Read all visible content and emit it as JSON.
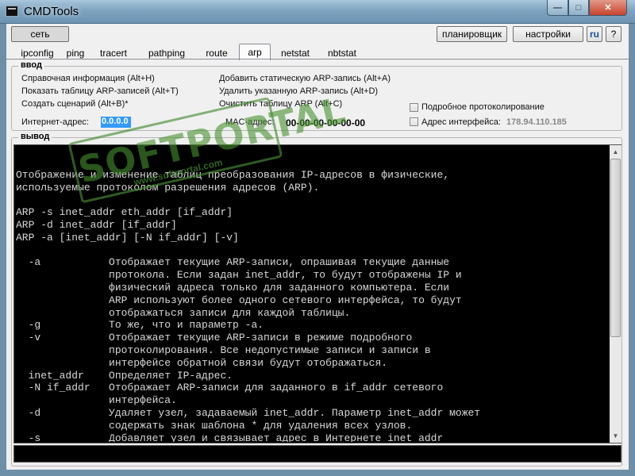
{
  "window": {
    "title": "CMDTools",
    "minimize_glyph": "—",
    "maximize_glyph": "□",
    "close_glyph": "✕"
  },
  "toolbar": {
    "network_label": "сеть",
    "scheduler_label": "планировщик",
    "settings_label": "настройки",
    "lang_label": "ru",
    "help_label": "?"
  },
  "tabs": [
    {
      "label": "ipconfig",
      "active": false
    },
    {
      "label": "ping",
      "active": false
    },
    {
      "label": "tracert",
      "active": false
    },
    {
      "label": "pathping",
      "active": false
    },
    {
      "label": "route",
      "active": false
    },
    {
      "label": "arp",
      "active": true
    },
    {
      "label": "netstat",
      "active": false
    },
    {
      "label": "nbtstat",
      "active": false
    }
  ],
  "input_group": {
    "legend": "ввод",
    "actions_left": [
      "Справочная информация (Alt+H)",
      "Показать таблицу ARP-записей (Alt+T)",
      "Создать сценарий (Alt+B)*"
    ],
    "actions_right": [
      "Добавить статическую ARP-запись (Alt+A)",
      "Удалить указанную ARP-запись (Alt+D)",
      "Очистить таблицу ARP (Alt+C)"
    ],
    "internet_address_label": "Интернет-адрес:",
    "internet_address_value": "0.0.0.0",
    "mac_address_label": "MAC-адрес:",
    "mac_address_value": "00-00-00-00-00-00",
    "verbose_log_label": "Подробное протоколирование",
    "verbose_log_checked": false,
    "interface_address_label": "Адрес интерфейса:",
    "interface_address_checked": false,
    "interface_address_value": "178.94.110.185"
  },
  "output_group": {
    "legend": "вывод",
    "console_lines": [
      "",
      "Отображение и изменение таблиц преобразования IP-адресов в физические,",
      "используемые протоколом разрешения адресов (ARP).",
      "",
      "ARP -s inet_addr eth_addr [if_addr]",
      "ARP -d inet_addr [if_addr]",
      "ARP -a [inet_addr] [-N if_addr] [-v]",
      "",
      "  -a           Отображает текущие ARP-записи, опрашивая текущие данные",
      "               протокола. Если задан inet_addr, то будут отображены IP и",
      "               физический адреса только для заданного компьютера. Если",
      "               ARP используют более одного сетевого интерфейса, то будут",
      "               отображаться записи для каждой таблицы.",
      "  -g           То же, что и параметр -a.",
      "  -v           Отображает текущие ARP-записи в режиме подробного",
      "               протоколирования. Все недопустимые записи и записи в",
      "               интерфейсе обратной связи будут отображаться.",
      "  inet_addr    Определяет IP-адрес.",
      "  -N if_addr   Отображает ARP-записи для заданного в if_addr сетевого",
      "               интерфейса.",
      "  -d           Удаляет узел, задаваемый inet_addr. Параметр inet_addr может",
      "               содержать знак шаблона * для удаления всех узлов.",
      "  -s           Добавляет узел и связывает адрес в Интернете inet_addr"
    ],
    "command_input_value": ""
  },
  "watermark": {
    "text": "SOFTPORTAL",
    "url": "www.softportal.com",
    "color": "#3f9b2e"
  },
  "colors": {
    "titlebar": "#7fa4c0",
    "console_bg": "#000000",
    "console_fg": "#d8d8d8",
    "selection": "#3399ff"
  }
}
